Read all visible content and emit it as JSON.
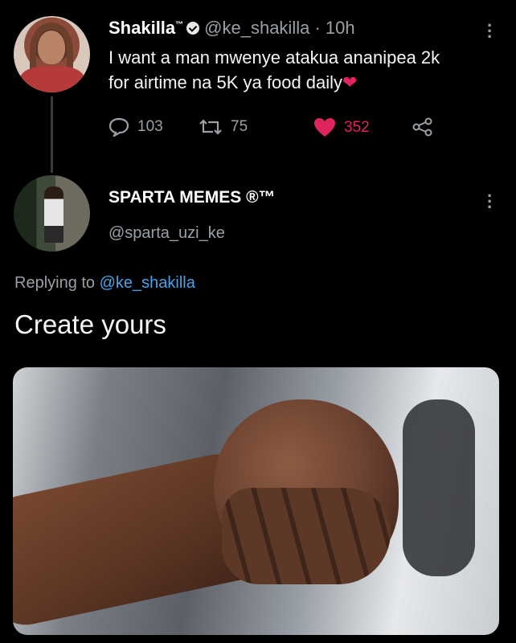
{
  "original_tweet": {
    "display_name": "Shakilla",
    "name_badge": "™",
    "handle": "@ke_shakilla",
    "separator": "·",
    "time": "10h",
    "text_line1": "I want a man mwenye atakua ananipea 2k",
    "text_line2": "for airtime na 5K ya food daily",
    "emoji": "❤",
    "replies": "103",
    "retweets": "75",
    "likes": "352",
    "like_color": "#e0245e"
  },
  "reply_tweet": {
    "display_name": "SPARTA MEMES ®™",
    "handle": "@sparta_uzi_ke",
    "replying_prefix": "Replying to",
    "replying_to": "@ke_shakilla",
    "text": "Create yours",
    "mention_color": "#4aa3e8"
  },
  "icons": {
    "reply": "reply-icon",
    "retweet": "retweet-icon",
    "like": "heart-icon",
    "share": "share-icon",
    "more": "more-icon",
    "verified": "verified-icon"
  }
}
